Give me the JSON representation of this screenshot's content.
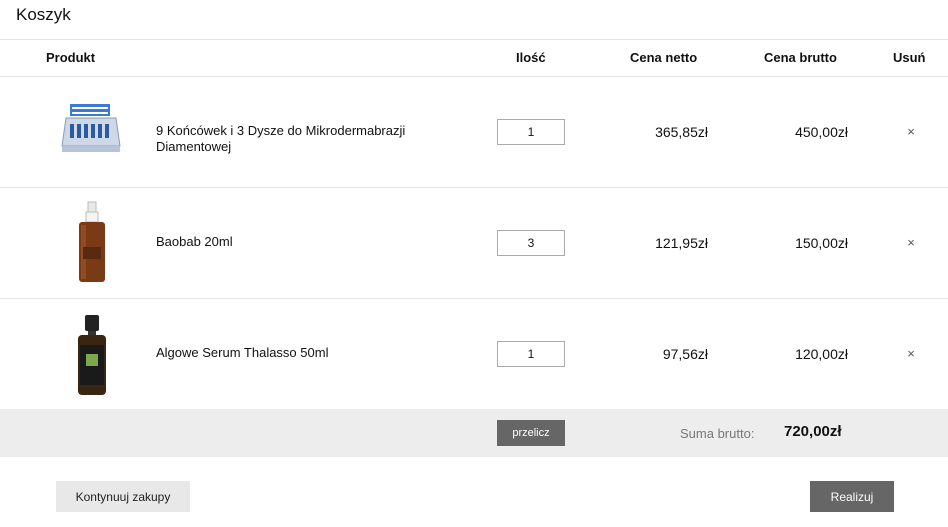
{
  "page_title": "Koszyk",
  "columns": {
    "product": "Produkt",
    "quantity": "Ilość",
    "net_price": "Cena netto",
    "gross_price": "Cena brutto",
    "remove": "Usuń"
  },
  "items": [
    {
      "name": "9 Końcówek i 3 Dysze do Mikrodermabrazji Diamentowej",
      "quantity": "1",
      "net": "365,85zł",
      "gross": "450,00zł",
      "remove_icon": "close-icon"
    },
    {
      "name": "Baobab 20ml",
      "quantity": "3",
      "net": "121,95zł",
      "gross": "150,00zł",
      "remove_icon": "close-icon"
    },
    {
      "name": "Algowe Serum Thalasso 50ml",
      "quantity": "1",
      "net": "97,56zł",
      "gross": "120,00zł",
      "remove_icon": "close-icon"
    }
  ],
  "summary": {
    "recalc_label": "przelicz",
    "total_label": "Suma brutto:",
    "total_value": "720,00zł"
  },
  "actions": {
    "continue_label": "Kontynuuj zakupy",
    "order_label": "Realizuj"
  },
  "remove_glyph": "×"
}
